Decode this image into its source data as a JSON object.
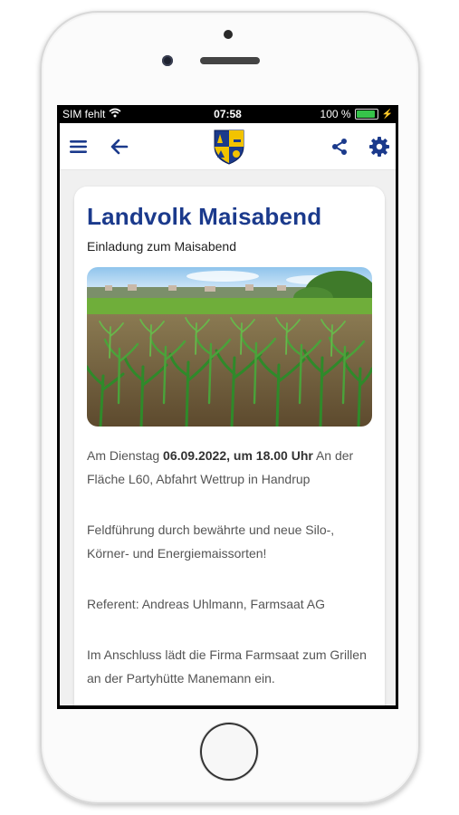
{
  "status_bar": {
    "carrier": "SIM fehlt",
    "time": "07:58",
    "battery_percent": "100 %",
    "battery_level": 1.0,
    "wifi_icon": "wifi-icon",
    "charging_icon": "lightning-icon"
  },
  "navbar": {
    "menu_icon": "hamburger-menu-icon",
    "back_icon": "arrow-left-icon",
    "share_icon": "share-icon",
    "settings_icon": "gear-icon",
    "logo": "coat-of-arms-logo",
    "accent_color": "#1b3a8c"
  },
  "article": {
    "title": "Landvolk Maisabend",
    "subtitle": "Einladung zum Maisabend",
    "image": "corn-field-photo",
    "p1": {
      "prefix": "Am Dienstag ",
      "bold": "06.09.2022, um 18.00 Uhr",
      "suffix": " An der Fläche L60, Abfahrt Wettrup in Handrup"
    },
    "p2": "Feldführung durch bewährte und neue Silo-, Körner- und Energiemaissorten!",
    "p3": "Referent: Andreas Uhlmann, Farmsaat AG",
    "p4": "Im Anschluss lädt die Firma Farmsaat zum Grillen an der Partyhütte Manemann ein."
  }
}
